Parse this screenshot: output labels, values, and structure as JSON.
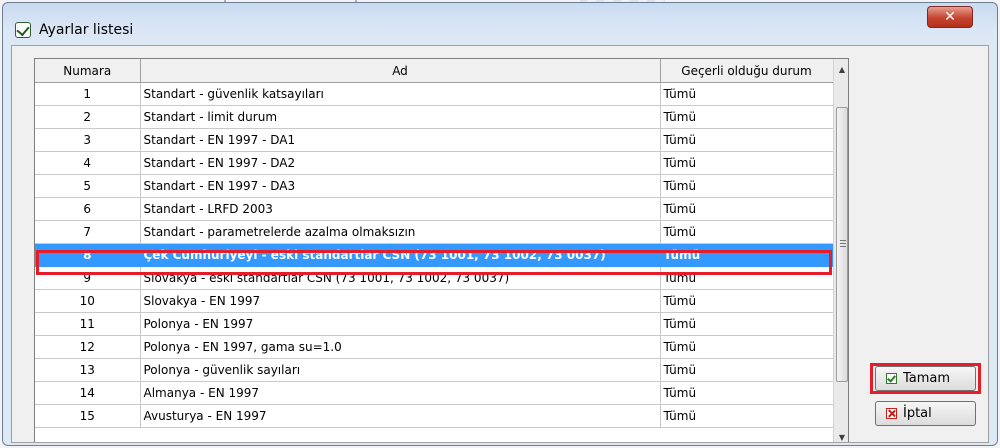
{
  "window": {
    "title": "Ayarlar listesi"
  },
  "table": {
    "columns": [
      "Numara",
      "Ad",
      "Geçerli olduğu durum"
    ],
    "rows": [
      {
        "num": "1",
        "name": "Standart - güvenlik katsayıları",
        "status": "Tümü"
      },
      {
        "num": "2",
        "name": "Standart - limit durum",
        "status": "Tümü"
      },
      {
        "num": "3",
        "name": "Standart - EN 1997 - DA1",
        "status": "Tümü"
      },
      {
        "num": "4",
        "name": "Standart - EN 1997 - DA2",
        "status": "Tümü"
      },
      {
        "num": "5",
        "name": "Standart - EN 1997 - DA3",
        "status": "Tümü"
      },
      {
        "num": "6",
        "name": "Standart - LRFD 2003",
        "status": "Tümü"
      },
      {
        "num": "7",
        "name": "Standart - parametrelerde azalma olmaksızın",
        "status": "Tümü"
      },
      {
        "num": "8",
        "name": "Çek Cumhuriyeyi - eski standartlar CSN (73 1001, 73 1002, 73 0037)",
        "status": "Tümü"
      },
      {
        "num": "9",
        "name": "Slovakya - eski standartlar CSN (73 1001, 73 1002, 73 0037)",
        "status": "Tümü"
      },
      {
        "num": "10",
        "name": "Slovakya - EN 1997",
        "status": "Tümü"
      },
      {
        "num": "11",
        "name": "Polonya - EN 1997",
        "status": "Tümü"
      },
      {
        "num": "12",
        "name": "Polonya - EN 1997, gama su=1.0",
        "status": "Tümü"
      },
      {
        "num": "13",
        "name": "Polonya - güvenlik sayıları",
        "status": "Tümü"
      },
      {
        "num": "14",
        "name": "Almanya - EN 1997",
        "status": "Tümü"
      },
      {
        "num": "15",
        "name": "Avusturya - EN 1997",
        "status": "Tümü"
      }
    ],
    "selected_row": "8"
  },
  "buttons": {
    "ok": "Tamam",
    "cancel": "İptal"
  },
  "icons": {
    "title": "checkmark-icon",
    "close": "close-icon",
    "ok": "checkmark-icon",
    "cancel": "cancel-x-icon"
  },
  "colors": {
    "selection": "#3399ff",
    "highlight_outline": "#e51d2a",
    "close_button": "#c4432f"
  }
}
